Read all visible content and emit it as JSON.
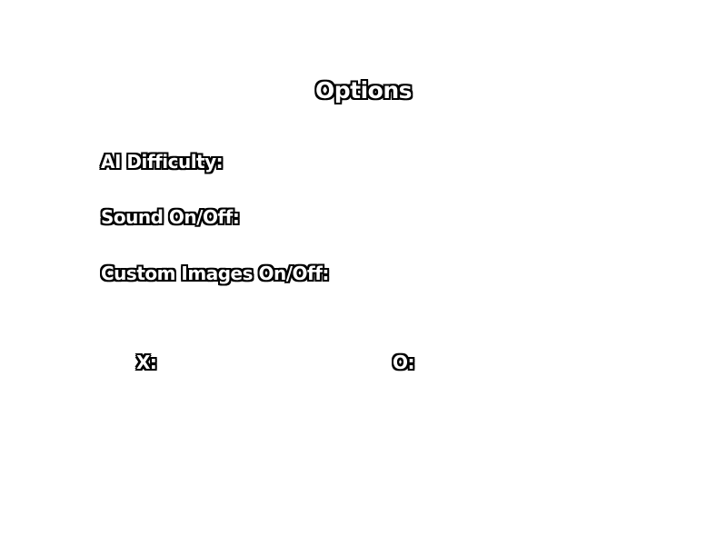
{
  "screen": {
    "title": "Options"
  },
  "options": {
    "ai_difficulty_label": "AI Difficulty:",
    "sound_label": "Sound On/Off:",
    "custom_images_label": "Custom Images On/Off:"
  },
  "players": {
    "x_label": "X:",
    "o_label": "O:"
  },
  "colors": {
    "background": "#ffffff",
    "text_fill": "#ffffff",
    "text_outline": "#000000"
  }
}
